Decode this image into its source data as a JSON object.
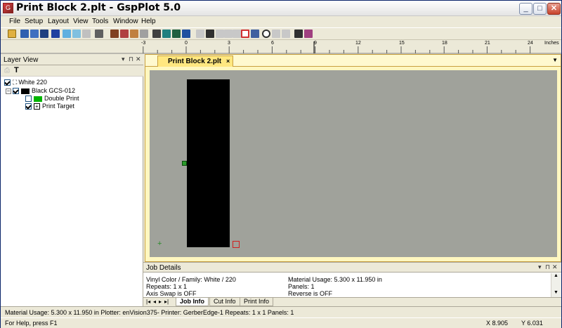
{
  "window": {
    "title": "Print Block 2.plt - GspPlot 5.0",
    "controls": {
      "minimize": "_",
      "maximize": "□",
      "close": "✕"
    },
    "app_icon": "gspplot-app-icon"
  },
  "menu": {
    "items": [
      {
        "label": "File"
      },
      {
        "label": "Setup"
      },
      {
        "label": "Layout"
      },
      {
        "label": "View"
      },
      {
        "label": "Tools"
      },
      {
        "label": "Window"
      },
      {
        "label": "Help"
      }
    ]
  },
  "ruler": {
    "labels": [
      "-3",
      "0",
      "3",
      "6",
      "9",
      "12",
      "15",
      "18",
      "21",
      "24"
    ],
    "unit": "Inches"
  },
  "layer_view": {
    "title": "Layer View",
    "tree": [
      {
        "label": "White 220",
        "checked": true,
        "icon": "vinyl-roll-icon"
      },
      {
        "label": "Black GCS-012",
        "checked": true,
        "expander": "−",
        "swatch": "#000000"
      },
      {
        "label": "Double Print",
        "checked": false,
        "swatch": "#00b400"
      },
      {
        "label": "Print Target",
        "checked": true,
        "icon": "target-icon"
      }
    ]
  },
  "document": {
    "tab_label": "Print Block 2.plt",
    "tab_close": "×",
    "canvas_color": "#a0a29b"
  },
  "job_details": {
    "title": "Job Details",
    "left": [
      "Vinyl Color / Family:  White / 220",
      "Repeats:  1 x 1",
      "Axis Swap is OFF"
    ],
    "right": [
      "Material Usage:  5.300 x 11.950 in",
      "Panels:  1",
      "Reverse is OFF"
    ],
    "tabs": [
      "Job Info",
      "Cut Info",
      "Print Info"
    ],
    "active_tab": "Job Info"
  },
  "info_bar": {
    "text": "Material Usage:  5.300 x 11.950 in    Plotter:  enVision375-  Printer:  GerberEdge-1  Repeats:  1 x 1  Panels:  1"
  },
  "status_bar": {
    "help": "For Help, press F1",
    "x": "X  8.905",
    "y": "Y  6.031"
  }
}
